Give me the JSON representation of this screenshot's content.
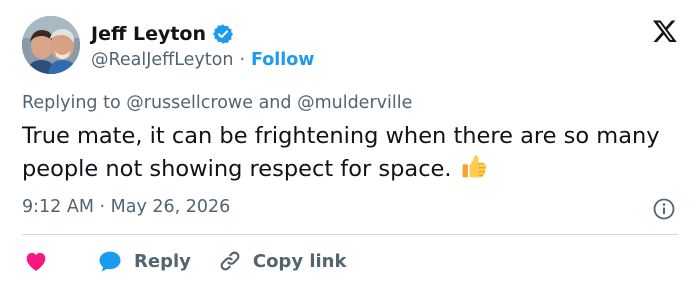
{
  "author": {
    "name": "Jeff Leyton",
    "handle": "@RealJeffLeyton",
    "separator": "·",
    "follow_label": "Follow"
  },
  "replying": {
    "prefix": "Replying to",
    "mention_1": "@russellcrowe",
    "conjunction": "and",
    "mention_2": "@mulderville"
  },
  "tweet": {
    "text": "True mate, it can be frightening when there are so many people not showing respect for space.",
    "emoji": "thumbs-up-emoji",
    "timestamp": "9:12 AM · May 26, 2026"
  },
  "actions": {
    "like_icon": "heart-icon",
    "reply_label": "Reply",
    "copy_link_label": "Copy link"
  },
  "colors": {
    "accent": "#1d9bf0",
    "like": "#f91880",
    "text": "#0f1419",
    "secondary_text": "#536471",
    "divider": "#cfd9de"
  }
}
